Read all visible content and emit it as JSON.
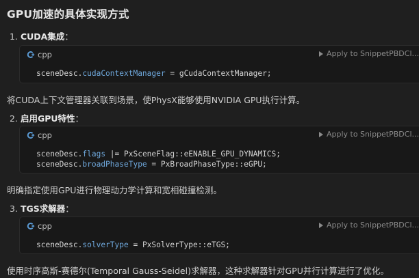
{
  "title": "GPU加速的具体实现方式",
  "steps": [
    {
      "num": "1.",
      "label": "CUDA集成",
      "colon": "："
    },
    {
      "num": "2.",
      "label": "启用GPU特性",
      "colon": "："
    },
    {
      "num": "3.",
      "label": "TGS求解器",
      "colon": "："
    }
  ],
  "code_blocks": [
    {
      "lang": "cpp",
      "apply_label": "Apply to SnippetPBDCl...",
      "lines": [
        [
          {
            "t": "sceneDesc",
            "c": "var"
          },
          {
            "t": ".",
            "c": "op"
          },
          {
            "t": "cudaContextManager",
            "c": "prop"
          },
          {
            "t": " = gCudaContextManager;",
            "c": "var"
          }
        ]
      ]
    },
    {
      "lang": "cpp",
      "apply_label": "Apply to SnippetPBDCl...",
      "lines": [
        [
          {
            "t": "sceneDesc",
            "c": "var"
          },
          {
            "t": ".",
            "c": "op"
          },
          {
            "t": "flags",
            "c": "prop"
          },
          {
            "t": " |= PxSceneFlag::eENABLE_GPU_DYNAMICS;",
            "c": "var"
          }
        ],
        [
          {
            "t": "sceneDesc",
            "c": "var"
          },
          {
            "t": ".",
            "c": "op"
          },
          {
            "t": "broadPhaseType",
            "c": "prop"
          },
          {
            "t": " = PxBroadPhaseType::eGPU;",
            "c": "var"
          }
        ]
      ]
    },
    {
      "lang": "cpp",
      "apply_label": "Apply to SnippetPBDCl...",
      "lines": [
        [
          {
            "t": "sceneDesc",
            "c": "var"
          },
          {
            "t": ".",
            "c": "op"
          },
          {
            "t": "solverType",
            "c": "prop"
          },
          {
            "t": " = PxSolverType::eTGS;",
            "c": "var"
          }
        ]
      ]
    }
  ],
  "paragraphs": [
    "将CUDA上下文管理器关联到场景，使PhysX能够使用NVIDIA GPU执行计算。",
    "明确指定使用GPU进行物理动力学计算和宽相碰撞检测。",
    "使用时序高斯-赛德尔(Temporal Gauss-Seidel)求解器，这种求解器针对GPU并行计算进行了优化。"
  ],
  "colors": {
    "background": "#1f1f1f",
    "code_background": "#181818",
    "property": "#6fa8dc",
    "cpp_icon": "#5b9bd5"
  },
  "icons": {
    "lang": "cpp-icon",
    "apply": "play-icon"
  }
}
